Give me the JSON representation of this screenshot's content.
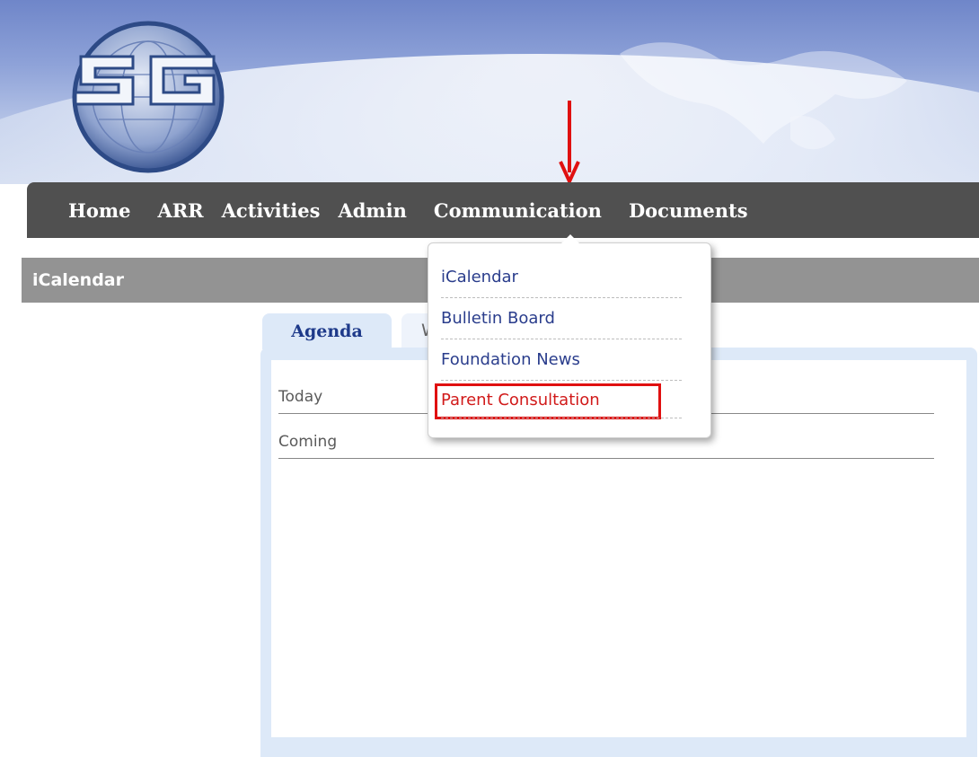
{
  "nav": {
    "items": [
      "Home",
      "ARR",
      "Activities",
      "Admin",
      "Communication",
      "Documents"
    ]
  },
  "section": {
    "title": "iCalendar"
  },
  "tabs": {
    "active": "Agenda",
    "inactive": "W"
  },
  "agenda": {
    "rows": [
      "Today",
      "Coming"
    ]
  },
  "dropdown": {
    "items": [
      "iCalendar",
      "Bulletin Board",
      "Foundation News",
      "Parent Consultation"
    ],
    "highlighted_index": 3
  },
  "colors": {
    "nav_bg": "#505050",
    "section_bg": "#939393",
    "tab_text": "#1e3a8a",
    "link": "#2a3d8c",
    "highlight": "#e01010"
  }
}
